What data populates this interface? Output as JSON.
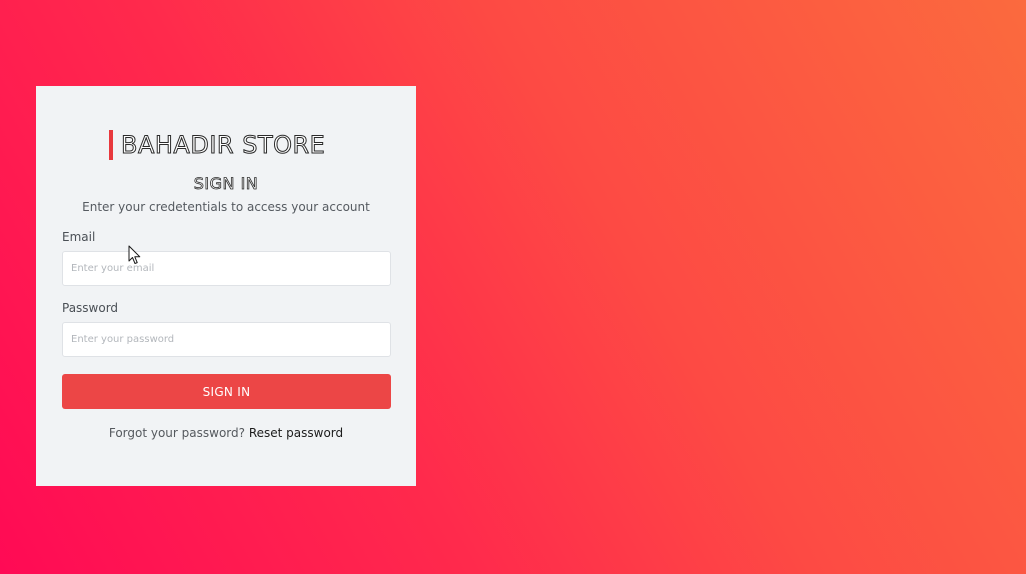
{
  "brand": {
    "name": "BAHADIR STORE",
    "accent_color": "#e8383d"
  },
  "form": {
    "title": "SIGN IN",
    "subtitle": "Enter your credetentials to access your account",
    "email": {
      "label": "Email",
      "placeholder": "Enter your email",
      "value": ""
    },
    "password": {
      "label": "Password",
      "placeholder": "Enter your password",
      "value": ""
    },
    "submit_label": "SIGN IN",
    "forgot_text": "Forgot your password?",
    "reset_link": "Reset password"
  },
  "colors": {
    "background_start": "#ff0a55",
    "background_end": "#fb6a3e",
    "card": "#f1f3f5",
    "button": "#ec4646"
  },
  "pointer": {
    "icon": "arrow-cursor-icon"
  }
}
